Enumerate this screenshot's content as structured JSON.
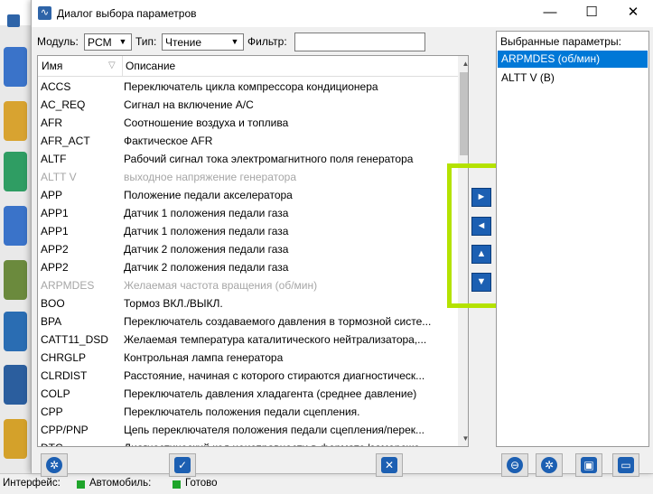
{
  "background_app": {
    "status": {
      "interface_label": "Интерфейс:",
      "car_label": "Автомобиль:",
      "ready_label": "Готово"
    }
  },
  "dialog": {
    "title": "Диалог выбора параметров",
    "window_buttons": {
      "minimize": "—",
      "maximize": "☐",
      "close": "✕"
    },
    "filters": {
      "module_label": "Модуль:",
      "module_value": "PCM",
      "type_label": "Тип:",
      "type_value": "Чтение",
      "filter_label": "Фильтр:",
      "filter_value": ""
    },
    "list": {
      "columns": {
        "name": "Имя",
        "description": "Описание"
      },
      "rows": [
        {
          "name": "ACCS",
          "desc": "Переключатель цикла компрессора кондиционера",
          "disabled": false
        },
        {
          "name": "AC_REQ",
          "desc": "Сигнал на включение A/C",
          "disabled": false
        },
        {
          "name": "AFR",
          "desc": "Соотношение воздуха и топлива",
          "disabled": false
        },
        {
          "name": "AFR_ACT",
          "desc": "Фактическое AFR",
          "disabled": false
        },
        {
          "name": "ALTF",
          "desc": "Рабочий сигнал тока электромагнитного поля генератора",
          "disabled": false
        },
        {
          "name": "ALTT V",
          "desc": "выходное напряжение генератора",
          "disabled": true
        },
        {
          "name": "APP",
          "desc": "Положение педали акселератора",
          "disabled": false
        },
        {
          "name": "APP1",
          "desc": "Датчик 1 положения педали газа",
          "disabled": false
        },
        {
          "name": "APP1",
          "desc": "Датчик 1 положения педали газа",
          "disabled": false
        },
        {
          "name": "APP2",
          "desc": "Датчик 2 положения педали газа",
          "disabled": false
        },
        {
          "name": "APP2",
          "desc": "Датчик 2 положения педали газа",
          "disabled": false
        },
        {
          "name": "ARPMDES",
          "desc": "Желаемая частота вращения (об/мин)",
          "disabled": true
        },
        {
          "name": "BOO",
          "desc": "Тормоз ВКЛ./ВЫКЛ.",
          "disabled": false
        },
        {
          "name": "BPA",
          "desc": "Переключатель создаваемого давления в тормозной систе...",
          "disabled": false
        },
        {
          "name": "CATT11_DSD",
          "desc": "Желаемая температура каталитического нейтрализатора,...",
          "disabled": false
        },
        {
          "name": "CHRGLP",
          "desc": "Контрольная лампа генератора",
          "disabled": false
        },
        {
          "name": "CLRDIST",
          "desc": "Расстояние, начиная с которого стираются диагностическ...",
          "disabled": false
        },
        {
          "name": "COLP",
          "desc": "Переключатель давления хладагента (среднее давление)",
          "disabled": false
        },
        {
          "name": "CPP",
          "desc": "Переключатель положения педали сцепления.",
          "disabled": false
        },
        {
          "name": "CPP/PNP",
          "desc": "Цепь переключателя положения педали сцепления/перек...",
          "disabled": false
        },
        {
          "name": "DTC",
          "desc": "Диагностический код неисправности в формате 'замороже...",
          "disabled": false
        }
      ]
    },
    "transfer_buttons": {
      "add": "►",
      "remove": "◄",
      "up": "▲",
      "down": "▼"
    },
    "selected": {
      "header": "Выбранные параметры:",
      "items": [
        "ARPMDES (об/мин)",
        "ALTT V (В)"
      ]
    },
    "toolbar_icons": [
      "settings-icon",
      "checkmark-icon",
      "close-icon",
      "trash-icon",
      "settings-icon",
      "save-icon",
      "folder-icon"
    ],
    "colors": {
      "accent": "#0078d7",
      "highlight_frame": "#b4e200",
      "button_blue": "#1c5fb2"
    }
  }
}
